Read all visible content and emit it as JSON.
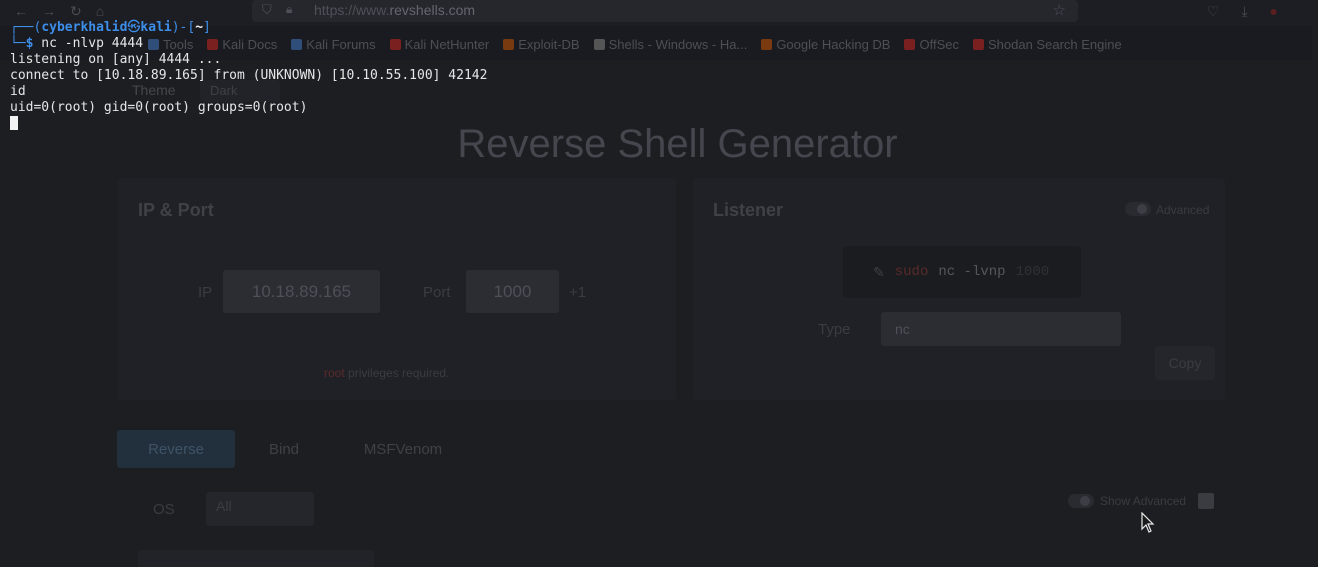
{
  "browser": {
    "url": {
      "prefix": "https://www.",
      "domain": "revshells.com"
    },
    "bookmarks": [
      {
        "label": "Tools",
        "icon": "kali-icon",
        "color": "#2f4f7a"
      },
      {
        "label": "Kali Docs",
        "icon": "kali-docs-icon",
        "color": "#7a2020"
      },
      {
        "label": "Kali Forums",
        "icon": "kali-forums-icon",
        "color": "#2f4f7a"
      },
      {
        "label": "Kali NetHunter",
        "icon": "nethunter-icon",
        "color": "#7a2020"
      },
      {
        "label": "Exploit-DB",
        "icon": "exploit-db-icon",
        "color": "#7a3a10"
      },
      {
        "label": "Shells - Windows - Ha...",
        "icon": "shells-icon",
        "color": "#555555"
      },
      {
        "label": "Google Hacking DB",
        "icon": "ghdb-icon",
        "color": "#7a3a10"
      },
      {
        "label": "OffSec",
        "icon": "offsec-icon",
        "color": "#7a2020"
      },
      {
        "label": "Shodan Search Engine",
        "icon": "shodan-icon",
        "color": "#7a2020"
      }
    ],
    "page": {
      "theme_label": "Theme",
      "theme_value": "Dark",
      "title": "Reverse Shell Generator",
      "ip_port": {
        "title": "IP & Port",
        "ip_label": "IP",
        "ip_value": "10.18.89.165",
        "port_label": "Port",
        "port_value": "1000",
        "increment": "+1",
        "note_prefix": "root",
        "note_rest": " privileges required."
      },
      "listener": {
        "title": "Listener",
        "advanced_label": "Advanced",
        "command_sudo": "sudo",
        "command": "nc -lvnp",
        "command_port": "1000",
        "type_label": "Type",
        "type_value": "nc",
        "copy_label": "Copy"
      },
      "tabs": [
        "Reverse",
        "Bind",
        "MSFVenom"
      ],
      "os_label": "OS",
      "os_value": "All",
      "show_advanced_label": "Show Advanced"
    }
  },
  "terminal": {
    "prompt": {
      "open": "┌──(",
      "user": "cyberkhalid",
      "at": "㉿",
      "host": "kali",
      "mid": ")-[",
      "dir": "~",
      "close": "]",
      "prefix": "└─",
      "symbol": "$",
      "command": " nc -nlvp 4444"
    },
    "output": [
      "listening on [any] 4444 ...",
      "connect to [10.18.89.165] from (UNKNOWN) [10.10.55.100] 42142",
      "id",
      "uid=0(root) gid=0(root) groups=0(root)"
    ]
  }
}
